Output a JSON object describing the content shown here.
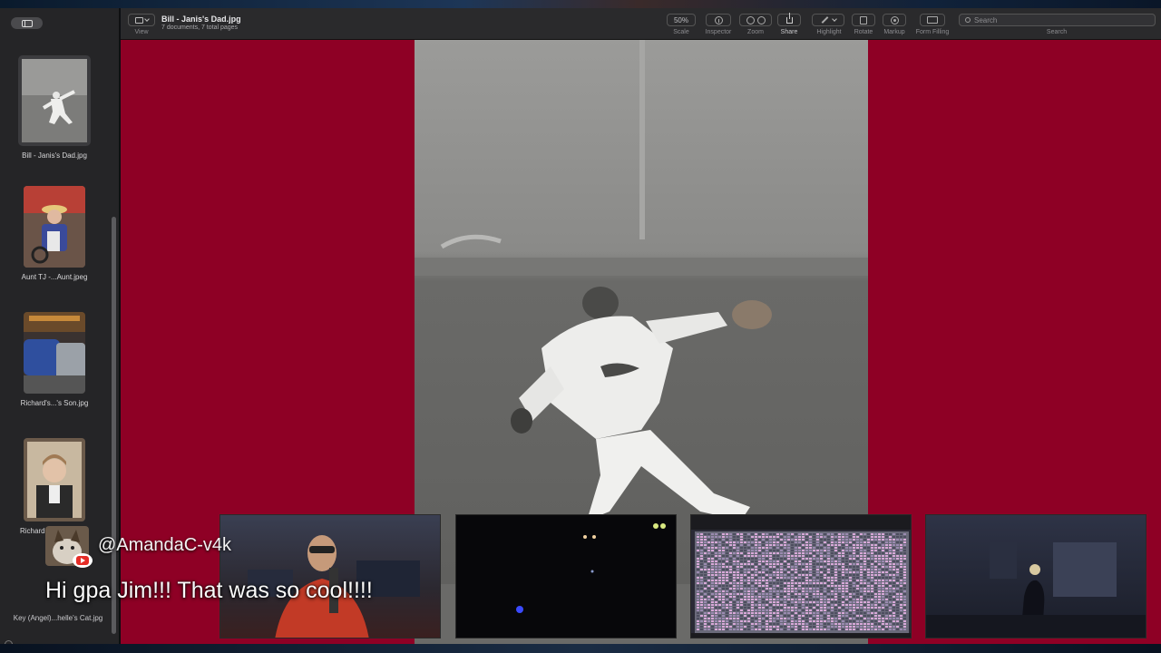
{
  "window": {
    "title": "Bill - Janis's Dad.jpg",
    "subtitle": "7 documents, 7 total pages"
  },
  "toolbar": {
    "view_label": "View",
    "scale_value": "50%",
    "scale_label": "Scale",
    "inspector_label": "Inspector",
    "zoom_label": "Zoom",
    "share_label": "Share",
    "highlight_label": "Highlight",
    "rotate_label": "Rotate",
    "markup_label": "Markup",
    "form_filling_label": "Form Filling",
    "search_label": "Search",
    "search_placeholder": "Search"
  },
  "sidebar": {
    "items": [
      {
        "label": "Bill - Janis's Dad.jpg",
        "selected": true
      },
      {
        "label": "Aunt TJ -...Aunt.jpeg",
        "selected": false
      },
      {
        "label": "Richard's...'s Son.jpg",
        "selected": false
      },
      {
        "label": "Richard",
        "selected": false
      }
    ],
    "bottom_label": "Key (Angel)...helle's Cat.jpg"
  },
  "document": {
    "background_color": "#8e0025"
  },
  "stream": {
    "chat_username": "@AmandaC-v4k",
    "chat_message": "Hi gpa Jim!!! That was so cool!!!!",
    "platform_icon": "youtube-icon"
  }
}
